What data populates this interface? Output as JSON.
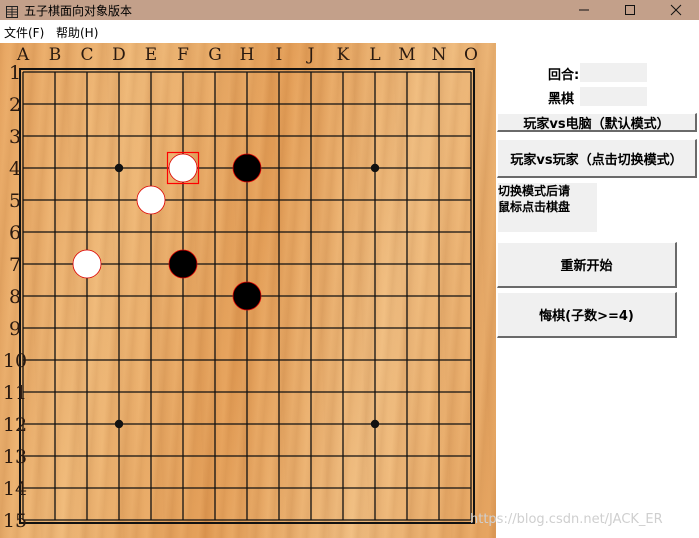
{
  "window": {
    "title": "五子棋面向对象版本",
    "controls": [
      "minimize",
      "maximize",
      "close"
    ]
  },
  "menu": {
    "items": [
      {
        "label": "文件(F)"
      },
      {
        "label": "帮助(H)"
      }
    ]
  },
  "board": {
    "size": 15,
    "column_labels": [
      "A",
      "B",
      "C",
      "D",
      "E",
      "F",
      "G",
      "H",
      "I",
      "J",
      "K",
      "L",
      "M",
      "N",
      "O"
    ],
    "row_labels": [
      "1",
      "2",
      "3",
      "4",
      "5",
      "6",
      "7",
      "8",
      "9",
      "10",
      "11",
      "12",
      "13",
      "14",
      "15"
    ],
    "star_points": [
      {
        "col": "D",
        "row": 4
      },
      {
        "col": "L",
        "row": 4
      },
      {
        "col": "D",
        "row": 12
      },
      {
        "col": "L",
        "row": 12
      }
    ],
    "stones": [
      {
        "color": "white",
        "col": "F",
        "row": 4
      },
      {
        "color": "black",
        "col": "H",
        "row": 4
      },
      {
        "color": "white",
        "col": "E",
        "row": 5
      },
      {
        "color": "white",
        "col": "C",
        "row": 7
      },
      {
        "color": "black",
        "col": "F",
        "row": 7
      },
      {
        "color": "black",
        "col": "H",
        "row": 8
      }
    ],
    "last_move": {
      "col": "F",
      "row": 4
    },
    "colors": {
      "grid": "#111111",
      "label": "#2a1a10",
      "white_stone": "#ffffff",
      "black_stone": "#000000",
      "stone_outline": "#dd0000",
      "last_move_marker": "#ff0000"
    }
  },
  "side": {
    "round_label": "回合:",
    "turn_label": "黑棋",
    "mode_pve_label": "玩家vs电脑（默认模式）",
    "mode_pvp_label": "玩家vs玩家（点击切换模式）",
    "hint_lines": [
      "切换模式后请",
      "鼠标点击棋盘"
    ],
    "restart_label": "重新开始",
    "undo_label": "悔棋(子数>=4)"
  },
  "watermark": "https://blog.csdn.net/JACK_ER"
}
